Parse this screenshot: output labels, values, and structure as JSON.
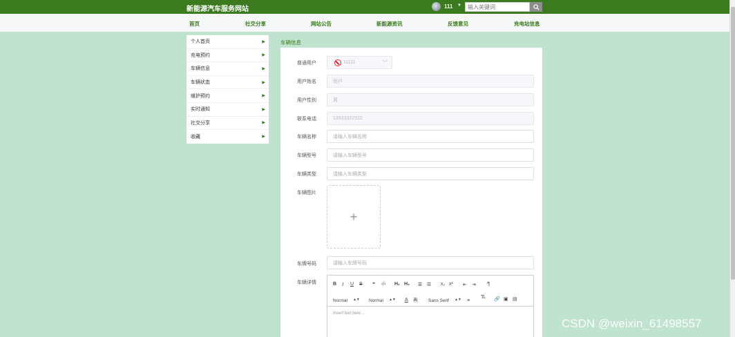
{
  "header": {
    "site_title": "新能源汽车服务网站",
    "username": "111",
    "search_placeholder": "输入关键词"
  },
  "nav": [
    "首页",
    "社交分享",
    "网站公告",
    "新能源资讯",
    "反馈意见",
    "充电站信息"
  ],
  "sidebar": {
    "items": [
      "个人首页",
      "充电预约",
      "车辆信息",
      "车辆状态",
      "维护预约",
      "实时通知",
      "社交分享",
      "收藏"
    ]
  },
  "form": {
    "section_title": "车辆信息",
    "user_type_label": "普通用户",
    "user_type_value": "11111",
    "fields": [
      {
        "label": "用户姓名",
        "value": "用户",
        "disabled": true
      },
      {
        "label": "用户性别",
        "value": "男",
        "disabled": true
      },
      {
        "label": "联系电话",
        "value": "13533322322",
        "disabled": true
      },
      {
        "label": "车辆名称",
        "placeholder": "请输入车辆名称"
      },
      {
        "label": "车辆型号",
        "placeholder": "请输入车辆型号"
      },
      {
        "label": "车辆类型",
        "placeholder": "请输入车辆类型"
      },
      {
        "label": "车辆图片"
      },
      {
        "label": "车牌号码",
        "placeholder": "请输入车牌号码"
      },
      {
        "label": "车辆详情"
      }
    ],
    "upload_plus": "+",
    "editor": {
      "header_picker": "Normal",
      "size_picker": "Normal",
      "font_picker": "Sans Serif",
      "placeholder": "Insert text here ..."
    }
  },
  "watermark": "CSDN @weixin_61498557",
  "colors": {
    "header_bg": "#3b7a1e",
    "page_bg": "#c0e3cf",
    "accent": "#3b7a1e"
  }
}
